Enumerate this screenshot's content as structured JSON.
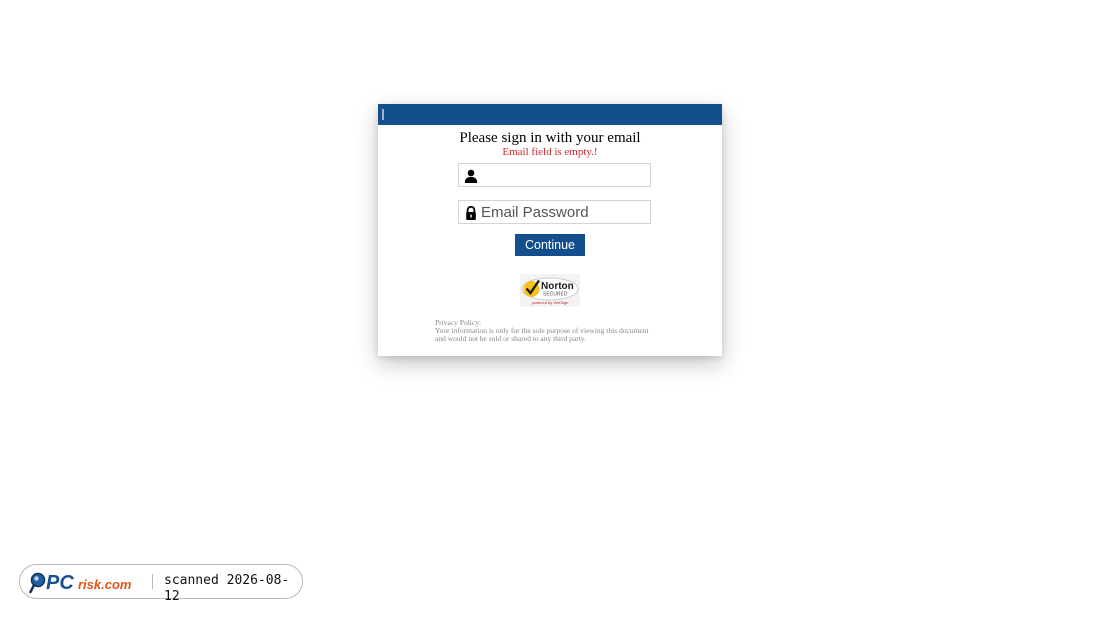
{
  "login": {
    "heading": "Please sign in with your email",
    "error": "Email field is empty.!",
    "email_value": "",
    "password_placeholder": "Email Password",
    "continue_label": "Continue",
    "badge": {
      "brand": "Norton",
      "sub": "SECURED",
      "powered": "powered by VeriSign"
    },
    "privacy_title": "Privacy Policy:",
    "privacy_line1": "Your information is only for the sole purpose of viewing this document",
    "privacy_line2": "and would not be sold or shared to any third party."
  },
  "watermark": {
    "brand": "PCrisk.com",
    "scanned": "scanned 2026-08-12"
  },
  "colors": {
    "header": "#134f8c",
    "button": "#134f8c",
    "error": "#d0262c"
  }
}
